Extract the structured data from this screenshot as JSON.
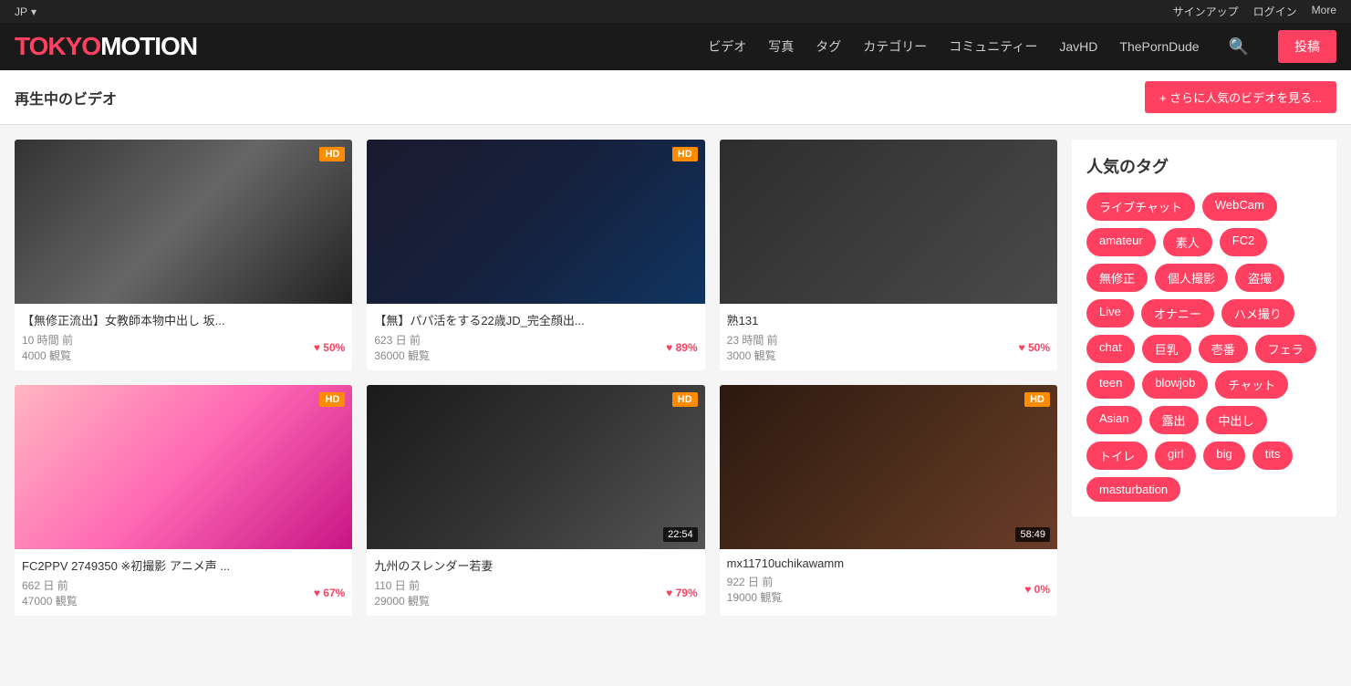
{
  "topbar": {
    "lang": "JP",
    "dropdown_icon": "▾",
    "signup": "サインアップ",
    "login": "ログイン",
    "more": "More"
  },
  "header": {
    "logo_tokyo": "TOKY",
    "logo_o": "O",
    "logo_motion": "MOTION",
    "nav_items": [
      {
        "label": "ビデオ",
        "href": "#"
      },
      {
        "label": "写真",
        "href": "#"
      },
      {
        "label": "タグ",
        "href": "#"
      },
      {
        "label": "カテゴリー",
        "href": "#"
      },
      {
        "label": "コミュニティー",
        "href": "#"
      },
      {
        "label": "JavHD",
        "href": "#"
      },
      {
        "label": "ThePornDude",
        "href": "#"
      }
    ],
    "post_button": "投稿"
  },
  "section": {
    "title": "再生中のビデオ",
    "more_button": "+ さらに人気のビデオを見る..."
  },
  "videos": [
    {
      "title": "【無修正流出】女教師本物中出し 坂...",
      "time_ago": "10 時間 前",
      "views": "4000 観覧",
      "rating": "50%",
      "hd": true,
      "duration": null,
      "thumb_class": "thumb-gradient-1"
    },
    {
      "title": "【無】パパ活をする22歳JD_完全顔出...",
      "time_ago": "623 日 前",
      "views": "36000 観覧",
      "rating": "89%",
      "hd": true,
      "duration": null,
      "thumb_class": "thumb-gradient-2"
    },
    {
      "title": "熟131",
      "time_ago": "23 時間 前",
      "views": "3000 観覧",
      "rating": "50%",
      "hd": false,
      "duration": null,
      "thumb_class": "thumb-gradient-3"
    },
    {
      "title": "FC2PPV 2749350 ※初撮影 アニメ声 ...",
      "time_ago": "662 日 前",
      "views": "47000 観覧",
      "rating": "67%",
      "hd": true,
      "duration": null,
      "thumb_class": "thumb-gradient-4"
    },
    {
      "title": "九州のスレンダー若妻",
      "time_ago": "110 日 前",
      "views": "29000 観覧",
      "rating": "79%",
      "hd": true,
      "duration": "22:54",
      "thumb_class": "thumb-gradient-5"
    },
    {
      "title": "mx11710uchikawamm",
      "time_ago": "922 日 前",
      "views": "19000 観覧",
      "rating": "0%",
      "hd": true,
      "duration": "58:49",
      "thumb_class": "thumb-gradient-6"
    }
  ],
  "sidebar": {
    "tags_title": "人気のタグ",
    "tags": [
      "ライブチャット",
      "WebCam",
      "amateur",
      "素人",
      "FC2",
      "無修正",
      "個人撮影",
      "盗撮",
      "Live",
      "オナニー",
      "ハメ撮り",
      "chat",
      "巨乳",
      "壱番",
      "フェラ",
      "teen",
      "blowjob",
      "チャット",
      "Asian",
      "露出",
      "中出し",
      "トイレ",
      "girl",
      "big",
      "tits",
      "masturbation"
    ]
  }
}
